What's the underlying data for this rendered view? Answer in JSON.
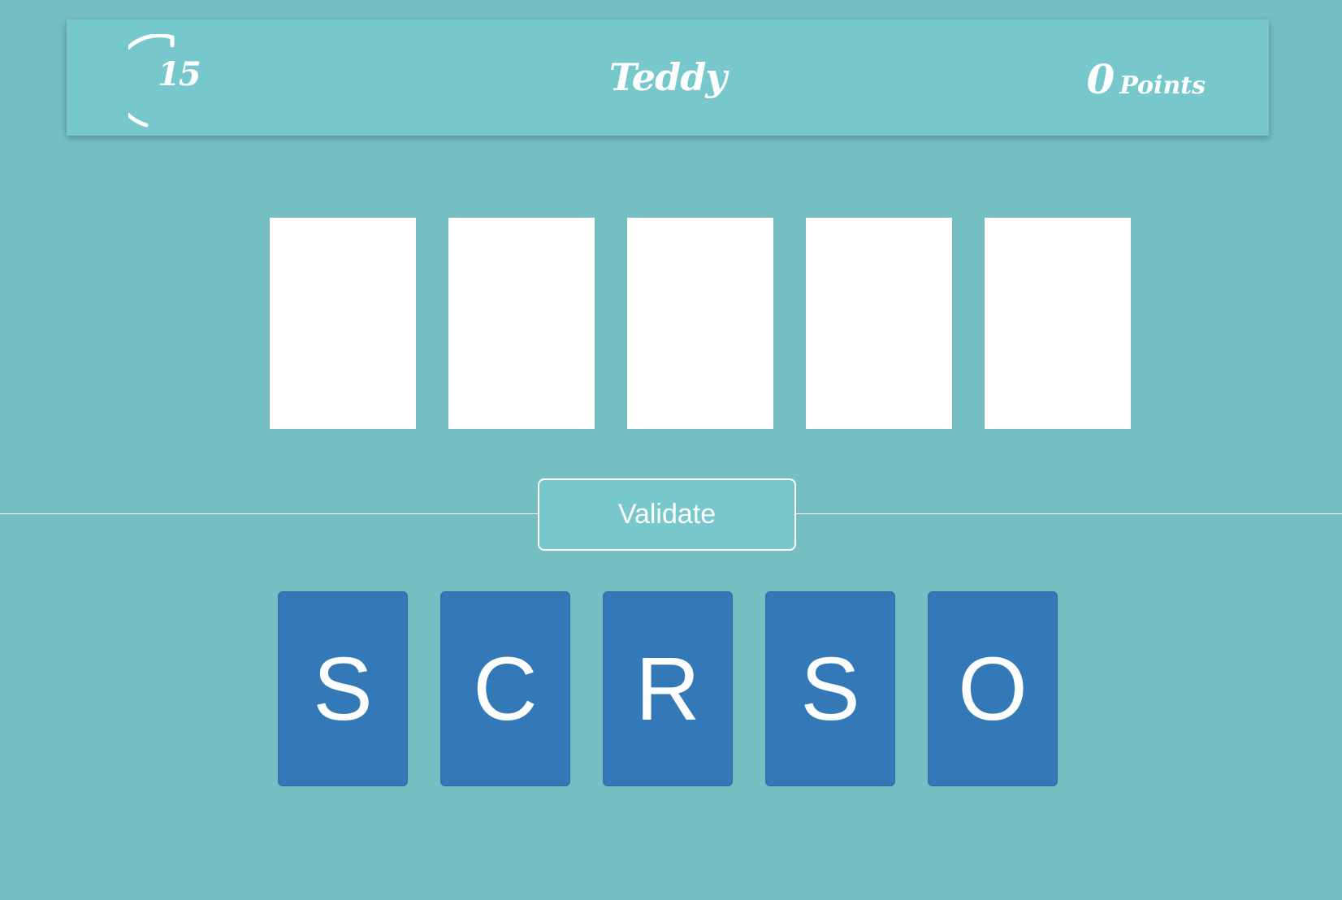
{
  "header": {
    "timer": "15",
    "player_name": "Teddy",
    "score": {
      "value": "0",
      "label": "Points"
    }
  },
  "answer_slots": [
    "",
    "",
    "",
    "",
    ""
  ],
  "validate_label": "Validate",
  "letter_tiles": [
    "S",
    "C",
    "R",
    "S",
    "O"
  ],
  "colors": {
    "background": "#75bfc3",
    "header": "#77c8cc",
    "tile": "#3479b7",
    "slot": "#ffffff",
    "text": "#ffffff"
  },
  "icons": {
    "timer": "timer-arc-icon"
  }
}
